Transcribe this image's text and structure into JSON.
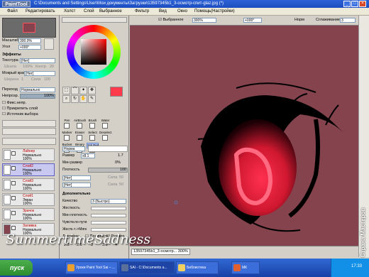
{
  "window": {
    "logo": "PaintTool SAI",
    "title": "C:\\Documents and Settings\\User\\Мои документы\\Загрузки\\13597345b1_3-осмотр-спит-glaz.jpg (*)",
    "btn_min": "_",
    "btn_max": "□",
    "btn_close": "×"
  },
  "menu": [
    "Файл",
    "Редактировать",
    "Холст",
    "Слой",
    "Выбранное",
    "Фильтр",
    "Вид",
    "Окно",
    "Помощь(Настройки)"
  ],
  "navigator": {
    "zoom_label": "Масштаб",
    "zoom_value": "300.0%",
    "angle_label": "Угол",
    "angle_value": "+000°"
  },
  "effects": {
    "header": "Эффекты",
    "texture_label": "Текстура",
    "texture_value": "[Нет]",
    "scale_label": "Шкала",
    "scale_value": "100%",
    "contrast_label": "Контр",
    "contrast_value": "20",
    "edge_label": "Мокрый край",
    "edge_value": "[Нет]",
    "width_label": "Ширина",
    "width_value": "1",
    "strength_label": "Сила",
    "strength_value": "100"
  },
  "layer_opts": {
    "mode_label": "Переход",
    "mode_value": "Нормально",
    "opacity_label": "Непрозр.",
    "opacity_value": "100%",
    "cb1": "Фикс.непр.",
    "cb2": "Прикрепить слой",
    "cb3": "Источник выбора"
  },
  "layers": [
    {
      "kind": "Лайнер",
      "mode": "Нормально",
      "opacity": "100%"
    },
    {
      "kind": "Слой2",
      "mode": "Нормально",
      "opacity": "100%"
    },
    {
      "kind": "Слой3",
      "mode": "Нормально",
      "opacity": "100%"
    },
    {
      "kind": "Слой1",
      "mode": "Экран",
      "opacity": "100%"
    },
    {
      "kind": "Зрачок",
      "mode": "Нормально",
      "opacity": "100%"
    },
    {
      "kind": "Заливка",
      "mode": "Нормально",
      "opacity": "100%"
    }
  ],
  "colors": {
    "primary": "#ff3a4a",
    "canvas": "#85434e"
  },
  "brushes": [
    [
      "Pen",
      "AirBrush",
      "Brush",
      "Water"
    ],
    [
      "Marker",
      "Eraser",
      "Select",
      "Deselect"
    ],
    [
      "Bucket",
      "Binary",
      "2sk Pen",
      ""
    ]
  ],
  "brush_props": {
    "mode_value": "Норма",
    "size_label": "Размер",
    "size_mult": "x8.1",
    "size_value": "1.7",
    "min_size_label": "Мин размер",
    "min_size_value": "0%",
    "density_label": "Плотность",
    "density_value": "100",
    "none1": "[Нет]",
    "none2": "[Нет]",
    "str1": "Сила",
    "str1_val": "50",
    "str2": "Сила",
    "str2_val": "50",
    "advanced": "Дополнительно",
    "quality_label": "Качество",
    "quality_value": "3 (Быстро)",
    "hardness_label": "Жесткость",
    "min_density_label": "Мин плотность",
    "max_speed_label": "Чувств.по пути",
    "pressure_label": "Жестк.<->Мягк",
    "pressure_mode": "Давление:",
    "cb_density": "Плотность",
    "cb_size": "Размер",
    "sizes": [
      "2.3",
      "2.6",
      "3",
      "3.5",
      "4"
    ]
  },
  "canvasbar": {
    "selected_label": "Выбранное",
    "zoom": "300%",
    "angle": "+000°",
    "norm": "Норм",
    "smooth_label": "Сглаживание",
    "smooth_value": "3"
  },
  "status": {
    "tab": "13597345b1_3-осмотр... 300%"
  },
  "taskbar": {
    "start": "пуск",
    "items": [
      "Уроки Paint Tool Sai – ...",
      "SAI - C:\\Documents a...",
      "Библиотека",
      "МК"
    ],
    "time": "17:33"
  },
  "watermark": "SummertimeSadness",
  "side_watermark": "Страна Мастеров"
}
